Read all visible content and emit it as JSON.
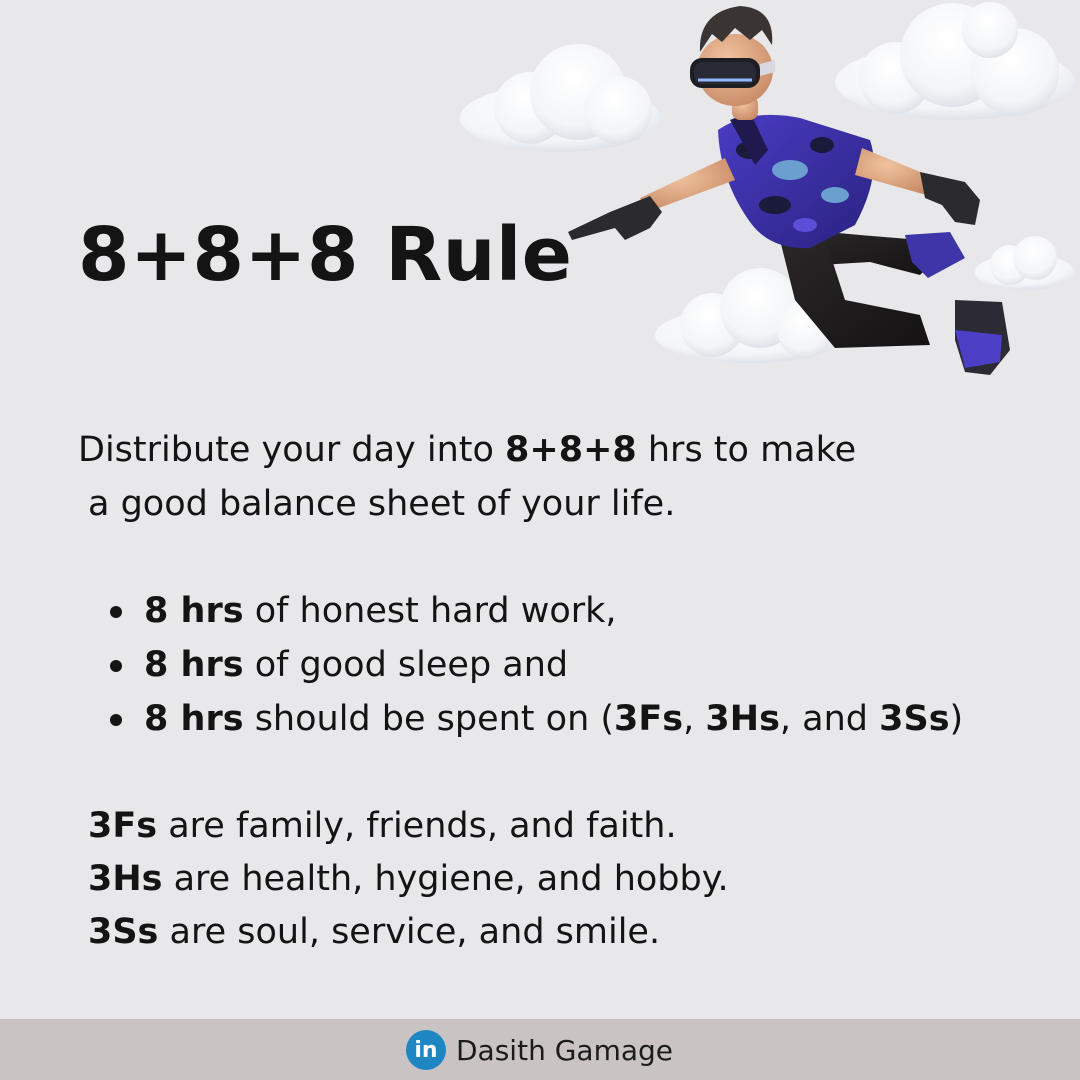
{
  "title": "8+8+8 Rule",
  "intro": {
    "l1_before": "Distribute your day into ",
    "l1_bold": "8+8+8",
    "l1_after": " hrs to make",
    "l2": "a good balance sheet of your life."
  },
  "bullets": [
    {
      "bold": "8 hrs",
      "text": " of honest hard work,"
    },
    {
      "bold": "8 hrs",
      "text": " of good sleep and"
    },
    {
      "bold": "8 hrs",
      "text": " should be spent on (",
      "b1": "3Fs",
      "sep1": ", ",
      "b2": "3Hs",
      "sep2": ", and ",
      "b3": "3Ss",
      "end": ")"
    }
  ],
  "definitions": [
    {
      "term": "3Fs",
      "text": " are family, friends, and faith."
    },
    {
      "term": "3Hs",
      "text": " are health, hygiene, and hobby."
    },
    {
      "term": "3Ss",
      "text": " are soul, service, and smile."
    }
  ],
  "footer": {
    "icon": "linkedin-icon",
    "icon_text": "in",
    "name": "Dasith Gamage"
  },
  "colors": {
    "background": "#e8e8ea",
    "footer": "#c9c4c3",
    "linkedin": "#1f86c4",
    "text": "#141414"
  }
}
